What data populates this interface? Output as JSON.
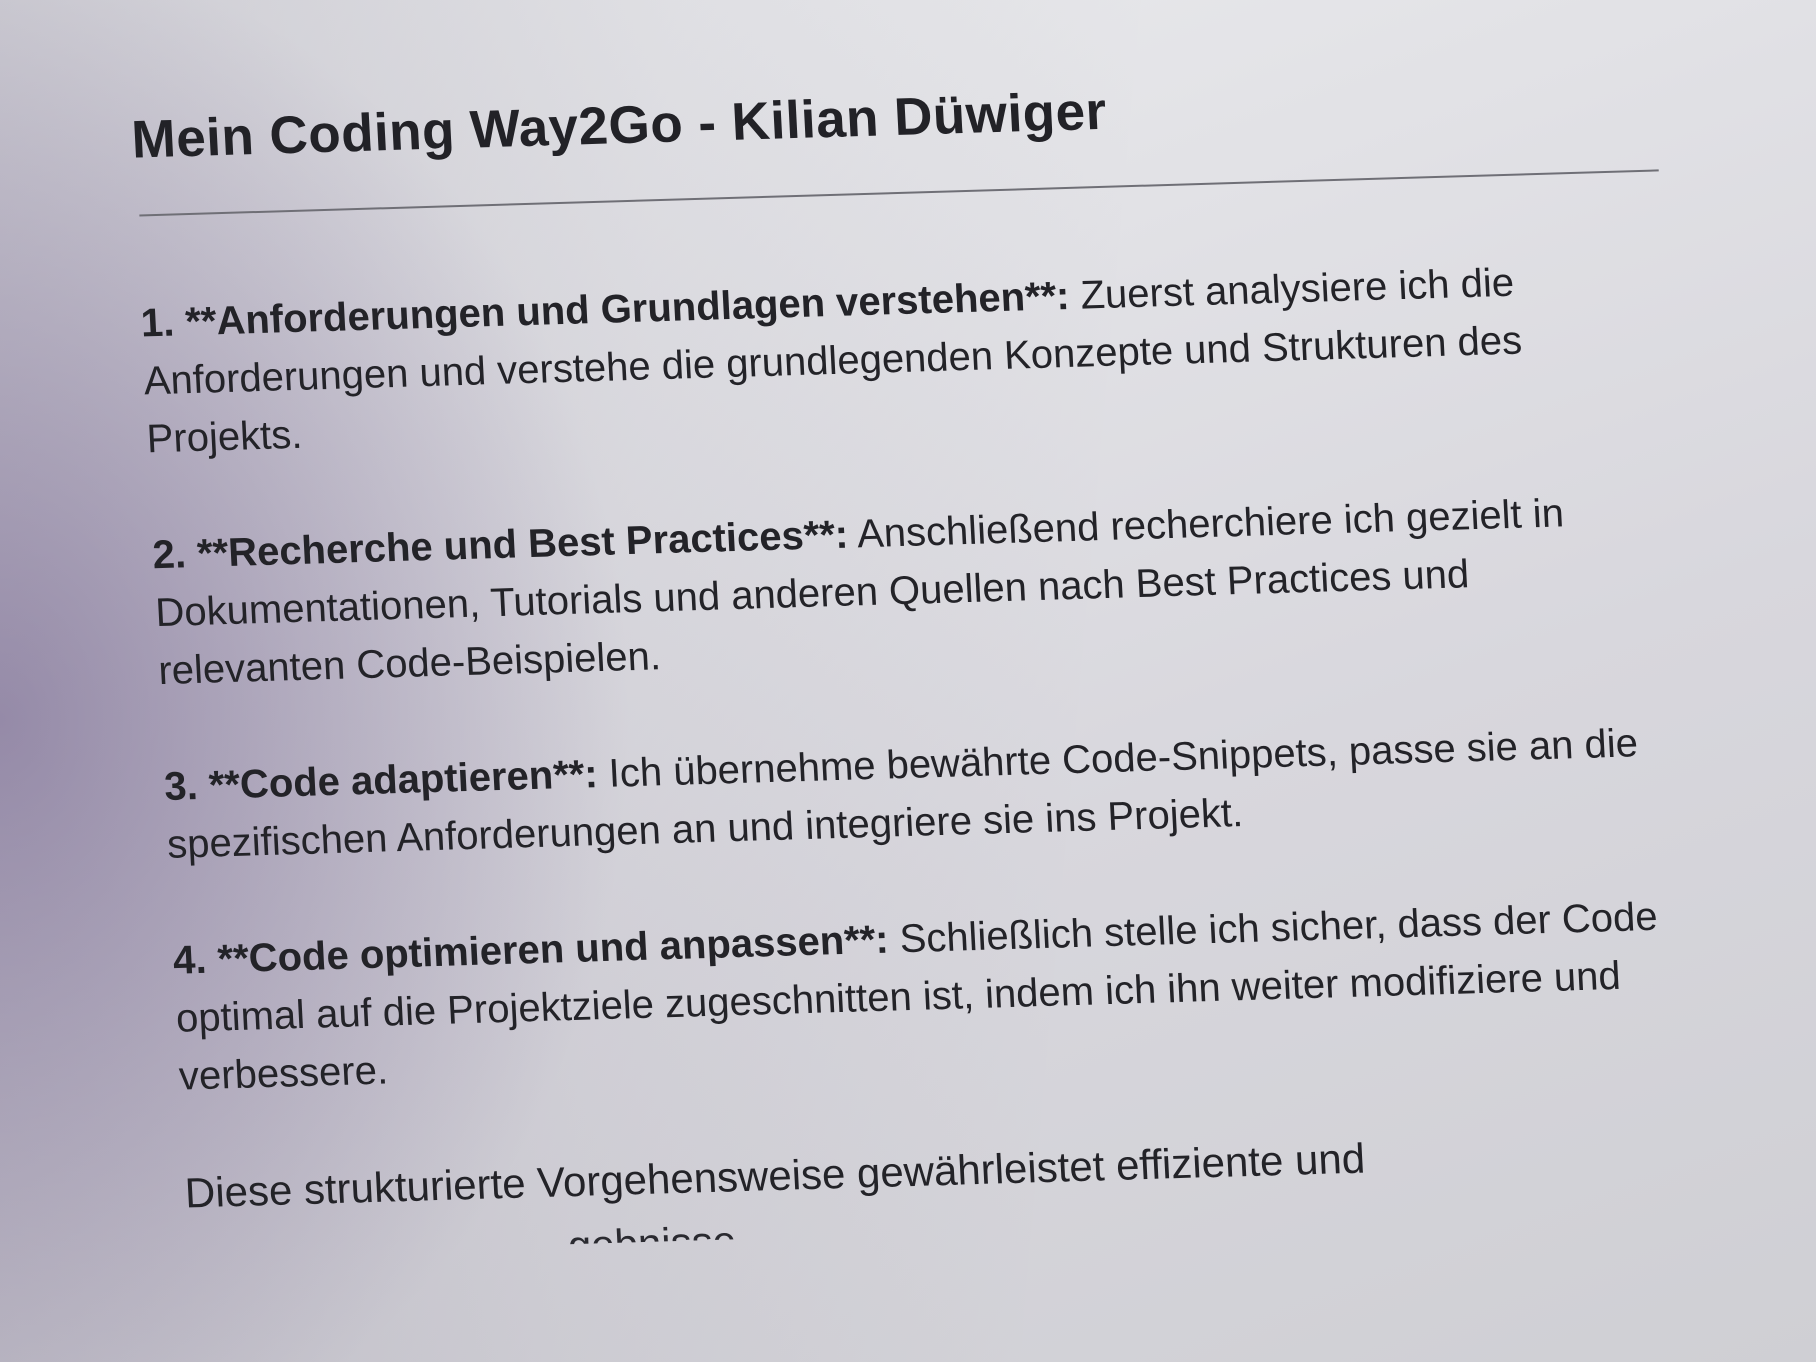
{
  "document": {
    "title": "Mein Coding Way2Go - Kilian Düwiger",
    "items": [
      {
        "number": "1.",
        "heading": "**Anforderungen und Grundlagen verstehen**:",
        "text": "Zuerst analysiere ich die Anforderungen und verstehe die grundlegenden Konzepte und Strukturen des Projekts."
      },
      {
        "number": "2.",
        "heading": "**Recherche und Best Practices**:",
        "text": "Anschließend recherchiere ich gezielt in Dokumentationen, Tutorials und anderen Quellen nach Best Practices und relevanten Code-Beispielen."
      },
      {
        "number": "3.",
        "heading": "**Code adaptieren**:",
        "text": "Ich übernehme bewährte Code-Snippets, passe sie an die spezifischen Anforderungen an und integriere sie ins Projekt."
      },
      {
        "number": "4.",
        "heading": "**Code optimieren und anpassen**:",
        "text": "Schließlich stelle ich sicher, dass der Code optimal auf die Projektziele zugeschnitten ist, indem ich ihn weiter modifiziere und verbessere."
      }
    ],
    "closing": "Diese strukturierte Vorgehensweise gewährleistet effiziente und",
    "closing_cut": "gebnisse"
  }
}
